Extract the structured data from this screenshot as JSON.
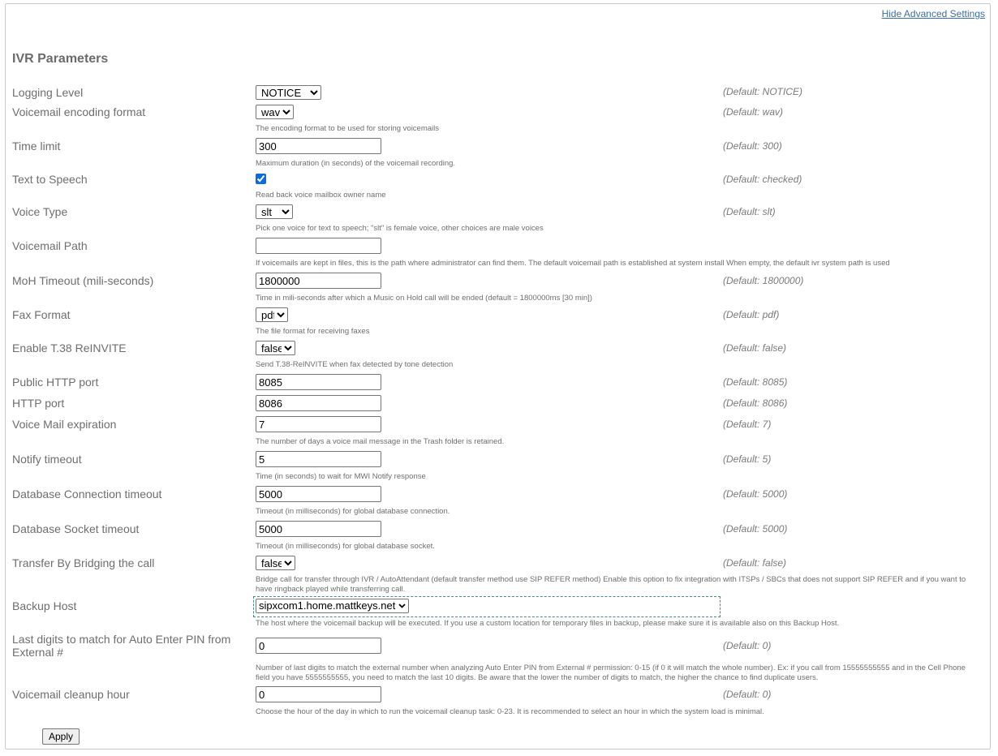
{
  "header": {
    "hide_advanced_label": "Hide Advanced Settings",
    "title": "IVR Parameters"
  },
  "fields": [
    {
      "label": "Logging Level",
      "type": "select",
      "value": "NOTICE",
      "default": "(Default: NOTICE)",
      "description": ""
    },
    {
      "label": "Voicemail encoding format",
      "type": "select",
      "value": "wav",
      "default": "(Default: wav)",
      "description": "The encoding format to be used for storing voicemails"
    },
    {
      "label": "Time limit",
      "type": "text",
      "value": "300",
      "default": "(Default: 300)",
      "description": "Maximum duration (in seconds) of the voicemail recording."
    },
    {
      "label": "Text to Speech",
      "type": "checkbox",
      "value": true,
      "default": "(Default: checked)",
      "description": "Read back voice mailbox owner name"
    },
    {
      "label": "Voice Type",
      "type": "select",
      "value": "slt",
      "default": "(Default: slt)",
      "description": "Pick one voice for text to speech; \"slt\" is female voice, other choices are male voices"
    },
    {
      "label": "Voicemail Path",
      "type": "text",
      "value": "",
      "default": "",
      "description": "If voicemails are kept in files, this is the path where administrator can find them. The default voicemail path is established at system install When empty, the default ivr system path is used"
    },
    {
      "label": "MoH Timeout (mili-seconds)",
      "type": "text",
      "value": "1800000",
      "default": "(Default: 1800000)",
      "description": "Time in mili-seconds after which a Music on Hold call will be ended (default = 1800000ms [30 min])"
    },
    {
      "label": "Fax Format",
      "type": "select",
      "value": "pdf",
      "default": "(Default: pdf)",
      "description": "The file format for receiving faxes"
    },
    {
      "label": "Enable T.38 ReINVITE",
      "type": "select",
      "value": "false",
      "default": "(Default: false)",
      "description": "Send T.38-ReINVITE when fax detected by tone detection"
    },
    {
      "label": "Public HTTP port",
      "type": "text",
      "value": "8085",
      "default": "(Default: 8085)",
      "description": ""
    },
    {
      "label": "HTTP port",
      "type": "text",
      "value": "8086",
      "default": "(Default: 8086)",
      "description": ""
    },
    {
      "label": "Voice Mail expiration",
      "type": "text",
      "value": "7",
      "default": "(Default: 7)",
      "description": "The number of days a voice mail message in the Trash folder is retained."
    },
    {
      "label": "Notify timeout",
      "type": "text",
      "value": "5",
      "default": "(Default: 5)",
      "description": "Time (in seconds) to wait for MWI Notify response"
    },
    {
      "label": "Database Connection timeout",
      "type": "text",
      "value": "5000",
      "default": "(Default: 5000)",
      "description": "Timeout (in milliseconds) for global database connection."
    },
    {
      "label": "Database Socket timeout",
      "type": "text",
      "value": "5000",
      "default": "(Default: 5000)",
      "description": "Timeout (in milliseconds) for global database socket."
    },
    {
      "label": "Transfer By Bridging the call",
      "type": "select",
      "value": "false",
      "default": "(Default: false)",
      "description": "Bridge call for transfer through IVR / AutoAttendant (default transfer method use SIP REFER method) Enable this option to fix integration with ITSPs / SBCs that does not support SIP REFER and if you want to have ringback played while transferring call."
    },
    {
      "label": "Backup Host",
      "type": "select",
      "value": "sipxcom1.home.mattkeys.net",
      "default": "",
      "description": "The host where the voicemail backup will be executed. If you use a custom location for temporary files in backup, please make sure it is available also on this Backup Host."
    },
    {
      "label": "Last digits to match for Auto Enter PIN from External #",
      "type": "text",
      "value": "0",
      "default": "(Default: 0)",
      "description": "Number of last digits to match the external number when analyzing Auto Enter PIN from External # permission: 0-15 (if 0 it will match the whole number). Ex: if you call from 15555555555 and in the Cell Phone field you have 5555555555, you need to match the last 10 digits. Be aware that the lower the number of digits to match, the higher the chance to find duplicate users."
    },
    {
      "label": "Voicemail cleanup hour",
      "type": "text",
      "value": "0",
      "default": "(Default: 0)",
      "description": "Choose the hour of the day in which to run the voicemail cleanup task: 0-23. It is recommended to select an hour in which the system load is minimal."
    }
  ],
  "apply_label": "Apply"
}
